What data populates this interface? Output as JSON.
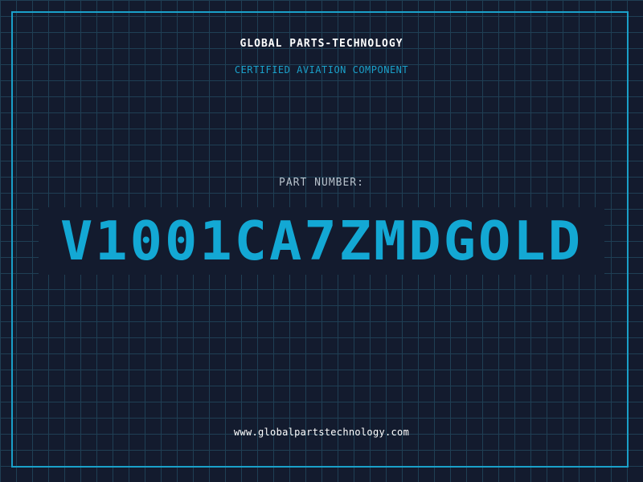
{
  "header": {
    "company": "GLOBAL PARTS-TECHNOLOGY",
    "subtitle": "CERTIFIED AVIATION COMPONENT"
  },
  "part": {
    "label": "PART NUMBER:",
    "number": "V1001CA7ZMDGOLD"
  },
  "footer": {
    "website": "www.globalpartstechnology.com"
  },
  "colors": {
    "background": "#131b2e",
    "grid": "#1f3f54",
    "accent": "#1aa0c9",
    "part_number": "#13a8d4",
    "label": "#b8c2cc",
    "text": "#ffffff"
  }
}
